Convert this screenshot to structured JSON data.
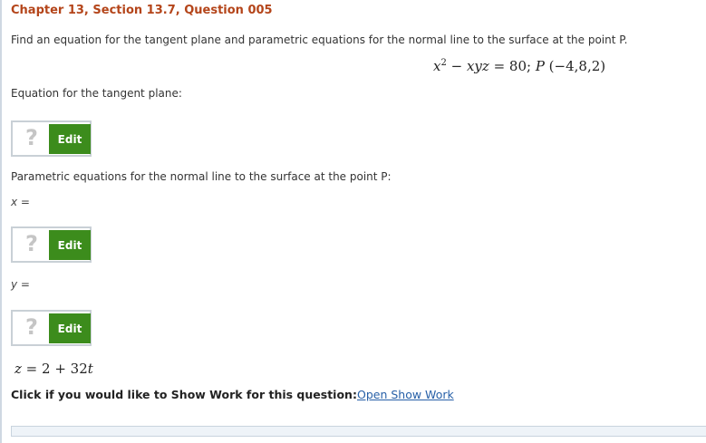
{
  "header": {
    "title": "Chapter 13, Section 13.7, Question 005"
  },
  "question": {
    "instruction": "Find an equation for the tangent plane and parametric equations for the normal line to the surface at the point P.",
    "equation": {
      "x": "x",
      "exp": "2",
      "minus": " − ",
      "xyz": "xyz",
      "equals": " = 80;   ",
      "P": "P",
      "point": " (−4,8,2)"
    }
  },
  "tangent_plane": {
    "label": "Equation for the tangent plane:",
    "edit_label": "Edit",
    "qmark": "?"
  },
  "normal_line": {
    "label": "Parametric equations for the normal line to the surface at the point P:",
    "x_label": "x =",
    "y_label": "y =",
    "edit_label": "Edit",
    "qmark": "?",
    "z_eq": {
      "z": "z",
      "mid": " = 2 + 32",
      "t": "t"
    }
  },
  "show_work": {
    "text": "Click if you would like to Show Work for this question:",
    "link": "Open Show Work"
  },
  "colors": {
    "title": "#b4451a",
    "edit_button": "#3c8c1c",
    "link": "#2760a8"
  }
}
